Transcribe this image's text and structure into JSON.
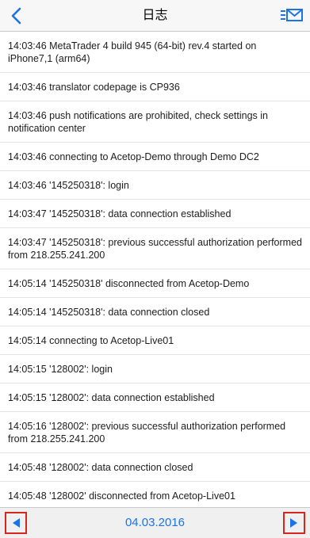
{
  "header": {
    "title": "日志",
    "back_icon": "chevron-left-icon",
    "action_icon": "mail-list-icon",
    "accent_color": "#1a73e8"
  },
  "log": [
    {
      "text": "14:03:46 MetaTrader 4 build 945 (64-bit) rev.4 started on iPhone7,1 (arm64)",
      "lines": 2
    },
    {
      "text": "14:03:46 translator codepage is CP936",
      "lines": 1
    },
    {
      "text": "14:03:46 push notifications are prohibited, check settings in notification center",
      "lines": 2
    },
    {
      "text": "14:03:46 connecting to Acetop-Demo through Demo DC2",
      "lines": 1
    },
    {
      "text": "14:03:46 '145250318': login",
      "lines": 1
    },
    {
      "text": "14:03:47 '145250318': data connection established",
      "lines": 1
    },
    {
      "text": "14:03:47 '145250318': previous successful authorization performed from 218.255.241.200",
      "lines": 2
    },
    {
      "text": "14:05:14 '145250318' disconnected from Acetop-Demo",
      "lines": 1
    },
    {
      "text": "14:05:14 '145250318': data connection closed",
      "lines": 1
    },
    {
      "text": "14:05:14 connecting to Acetop-Live01",
      "lines": 1
    },
    {
      "text": "14:05:15 '128002': login",
      "lines": 1
    },
    {
      "text": "14:05:15 '128002': data connection established",
      "lines": 1
    },
    {
      "text": "14:05:16 '128002': previous successful authorization performed from 218.255.241.200",
      "lines": 2
    },
    {
      "text": "14:05:48 '128002': data connection closed",
      "lines": 1
    },
    {
      "text": "14:05:48 '128002' disconnected from Acetop-Live01",
      "lines": 1
    }
  ],
  "footer": {
    "date": "04.03.2016",
    "prev_icon": "triangle-left-icon",
    "next_icon": "triangle-right-icon",
    "highlight_color": "#d6261e"
  }
}
